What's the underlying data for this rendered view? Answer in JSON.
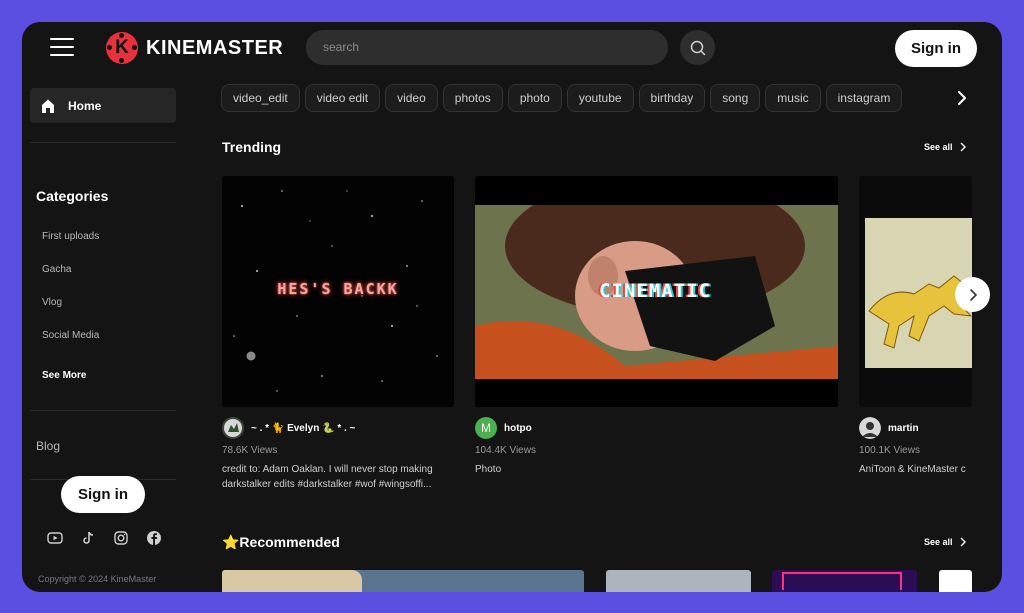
{
  "header": {
    "brand": "KINEMASTER",
    "brand_letter": "K",
    "search_placeholder": "search",
    "signin_label": "Sign in"
  },
  "sidebar": {
    "home_label": "Home",
    "categories_title": "Categories",
    "categories": [
      "First uploads",
      "Gacha",
      "Vlog",
      "Social Media"
    ],
    "see_more_label": "See More",
    "blog_label": "Blog",
    "signin_label": "Sign in",
    "socials": [
      "youtube-icon",
      "tiktok-icon",
      "instagram-icon",
      "facebook-icon"
    ],
    "copyright": "Copyright © 2024 KineMaster"
  },
  "tags": [
    "video_edit",
    "video edit",
    "video",
    "photos",
    "photo",
    "youtube",
    "birthday",
    "song",
    "music",
    "instagram"
  ],
  "trending": {
    "title": "Trending",
    "see_all_label": "See all",
    "cards": [
      {
        "overlay_text": "HES'S BACKK",
        "author": "~ . * 🐈 Evelyn 🐍 * . ~",
        "views": "78.6K Views",
        "description": "credit to: Adam Oaklan. I will never stop making darkstalker edits #darkstalker #wof #wingsoffi..."
      },
      {
        "overlay_text": "CINEMATIC",
        "author": "hotpo",
        "avatar_letter": "M",
        "views": "104.4K Views",
        "description": "Photo"
      },
      {
        "author": "martin",
        "views": "100.1K Views",
        "description": "AniToon & KineMaster c"
      }
    ]
  },
  "recommended": {
    "title": "⭐Recommended",
    "see_all_label": "See all"
  },
  "colors": {
    "background": "#5a4fe0",
    "window": "#141414",
    "brand_red": "#e8323b",
    "avatar_green": "#4caf50"
  }
}
